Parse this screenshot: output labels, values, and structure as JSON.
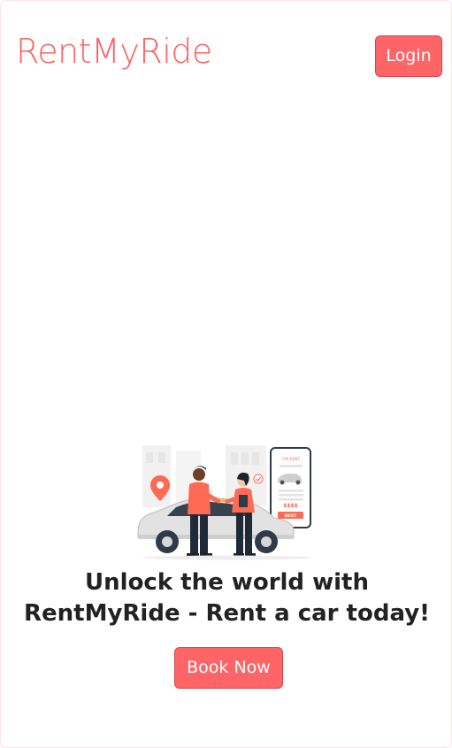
{
  "header": {
    "brand": "RentMyRide",
    "login_label": "Login"
  },
  "hero": {
    "illustration_icon": "car-rental-handover-illustration",
    "illustration_text": {
      "phone_caption": "CAR RENT",
      "price": "$$$$",
      "rent_button": "RENT"
    },
    "headline_line1": "Unlock the world with",
    "headline_line2": "RentMyRide - Rent a car today!",
    "cta_label": "Book Now"
  },
  "colors": {
    "accent": "#ff6466",
    "brand_text": "#ff5f63",
    "headline_text": "#222222"
  }
}
